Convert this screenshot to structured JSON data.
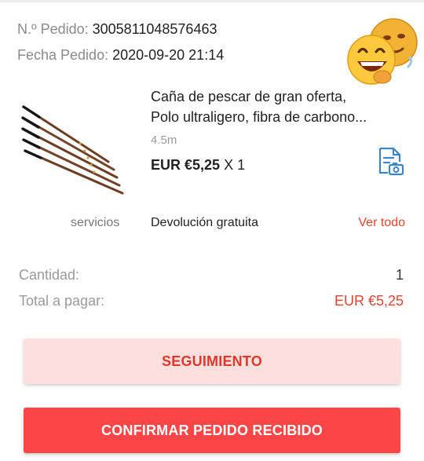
{
  "order": {
    "number_label": "N.º Pedido:",
    "number_value": "3005811048576463",
    "date_label": "Fecha Pedido:",
    "date_value": "2020-09-20 21:14"
  },
  "sticker_icon": "grinning-face-emoji-sticker",
  "product": {
    "image_icon": "fishing-rod-image",
    "title_line1": "Caña de pescar de gran oferta,",
    "title_line2": "Polo ultraligero, fibra de carbono...",
    "variant": "4.5m",
    "price": "EUR €5,25",
    "quantity": "X 1",
    "snapshot_icon": "order-snapshot-icon"
  },
  "services": {
    "label": "servicios",
    "value": "Devolución gratuita",
    "link": "Ver todo"
  },
  "summary": {
    "quantity_label": "Cantidad:",
    "quantity_value": "1",
    "total_label": "Total a pagar:",
    "total_value": "EUR €5,25"
  },
  "actions": {
    "tracking": "SEGUIMIENTO",
    "confirm": "CONFIRMAR PEDIDO RECIBIDO"
  },
  "colors": {
    "accent_red": "#e34431",
    "confirm_bg": "#fc4547",
    "tracking_bg": "#fde0dd",
    "icon_blue": "#3d84c8"
  }
}
